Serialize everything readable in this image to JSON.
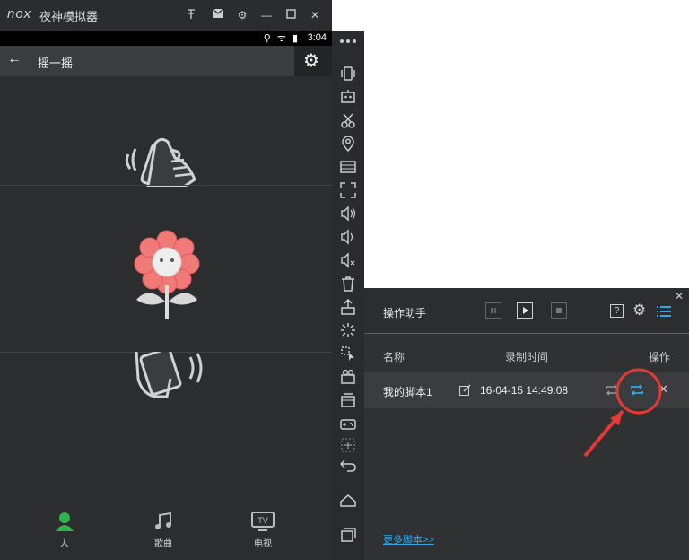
{
  "window": {
    "logo": "nox",
    "title": "夜神模拟器"
  },
  "statusbar": {
    "time": "3:04"
  },
  "appbar": {
    "title": "摇一摇"
  },
  "bottom_nav": [
    {
      "label": "人",
      "icon": "person-icon",
      "active": true
    },
    {
      "label": "歌曲",
      "icon": "music-icon",
      "active": false
    },
    {
      "label": "电视",
      "icon": "tv-icon",
      "active": false
    }
  ],
  "helper": {
    "title": "操作助手",
    "columns": {
      "name": "名称",
      "time": "录制时间",
      "action": "操作"
    },
    "script": {
      "name": "我的脚本1",
      "time": "16-04-15 14:49:08"
    },
    "more_link": "更多脚本>>"
  },
  "colors": {
    "accent": "#33a6e6",
    "highlight": "#e53935",
    "flower": "#f07878"
  }
}
